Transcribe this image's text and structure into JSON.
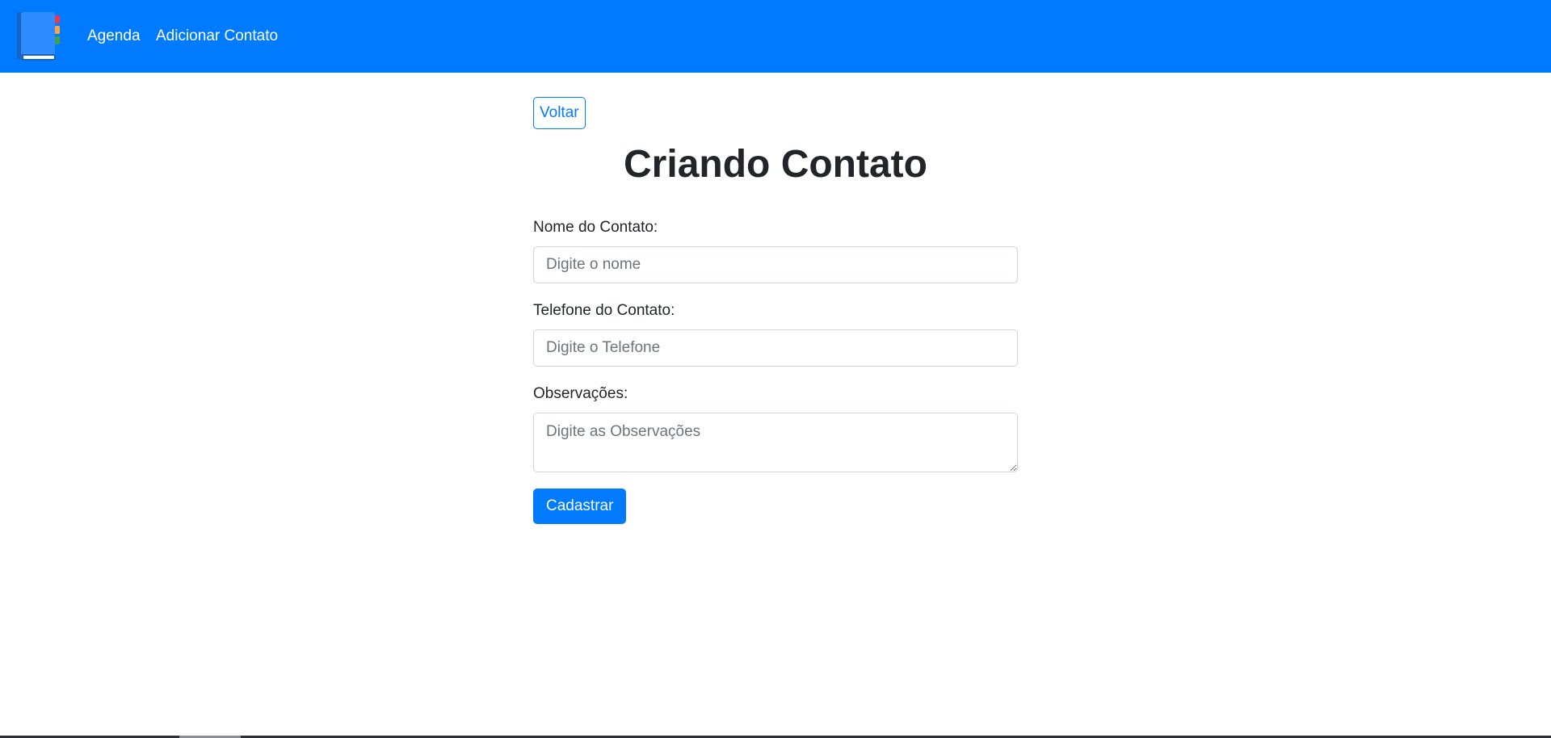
{
  "navbar": {
    "brand_icon": "address-book-icon",
    "links": [
      {
        "label": "Agenda"
      },
      {
        "label": "Adicionar Contato"
      }
    ],
    "color": "#007bff"
  },
  "main": {
    "back_label": "Voltar",
    "title": "Criando Contato",
    "form": {
      "name_label": "Nome do Contato:",
      "name_placeholder": "Digite o nome",
      "phone_label": "Telefone do Contato:",
      "phone_placeholder": "Digite o Telefone",
      "obs_label": "Observações:",
      "obs_placeholder": "Digite as Observações",
      "submit_label": "Cadastrar"
    }
  },
  "colors": {
    "primary": "#007bff",
    "text": "#212529",
    "placeholder": "#6c757d",
    "input_border": "#ced4da"
  }
}
